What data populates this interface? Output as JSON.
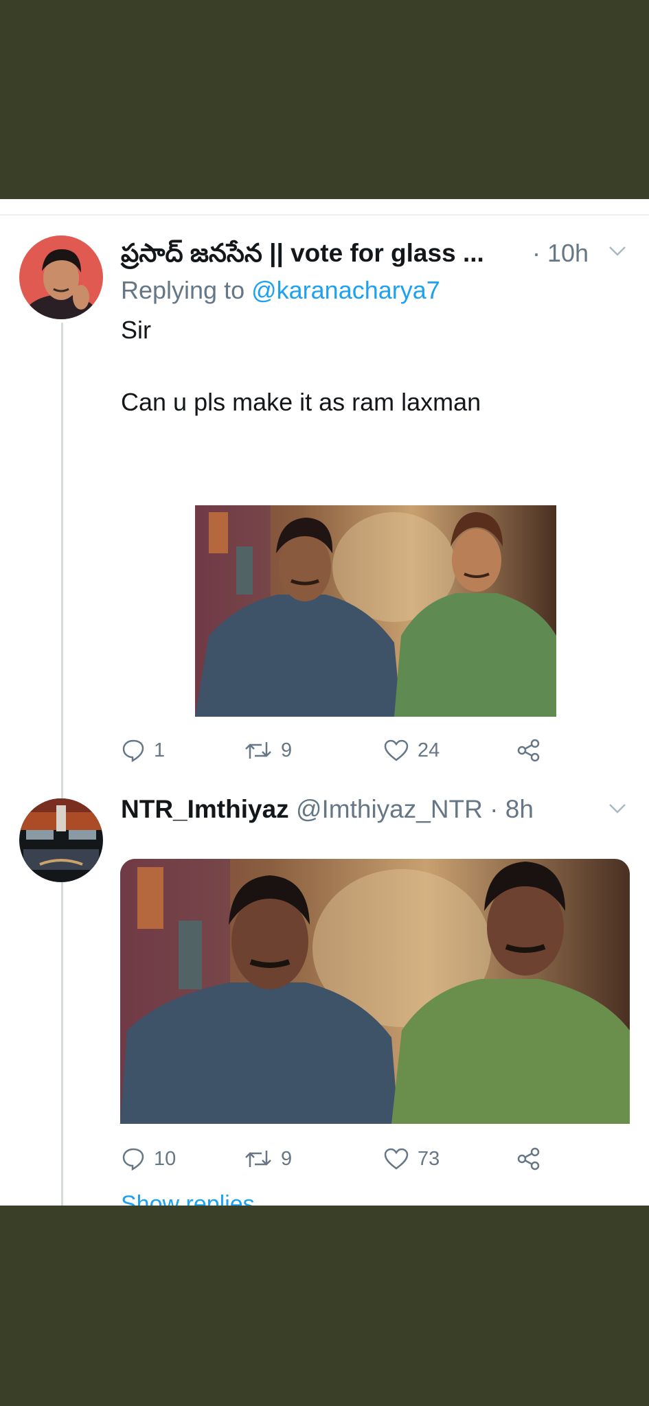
{
  "tweets": [
    {
      "display_name": "ప్రసాద్ జనసేన || vote for glass ...",
      "time": "· 10h",
      "replying_prefix": "Replying to ",
      "replying_handle": "@karanacharya7",
      "lines": [
        "Sir",
        "Can u pls make it as ram laxman"
      ],
      "replies": "1",
      "retweets": "9",
      "likes": "24"
    },
    {
      "display_name": "NTR_Imthiyaz",
      "handle": "@Imthiyaz_NTR",
      "time": "· 8h",
      "replies": "10",
      "retweets": "9",
      "likes": "73"
    }
  ],
  "show_replies": "Show replies",
  "colors": {
    "background_band": "#3a4028",
    "link": "#1da1f2",
    "text_primary": "#14171a",
    "text_secondary": "#657786"
  },
  "icons": [
    "reply-icon",
    "retweet-icon",
    "like-icon",
    "share-icon",
    "chevron-down-icon"
  ]
}
